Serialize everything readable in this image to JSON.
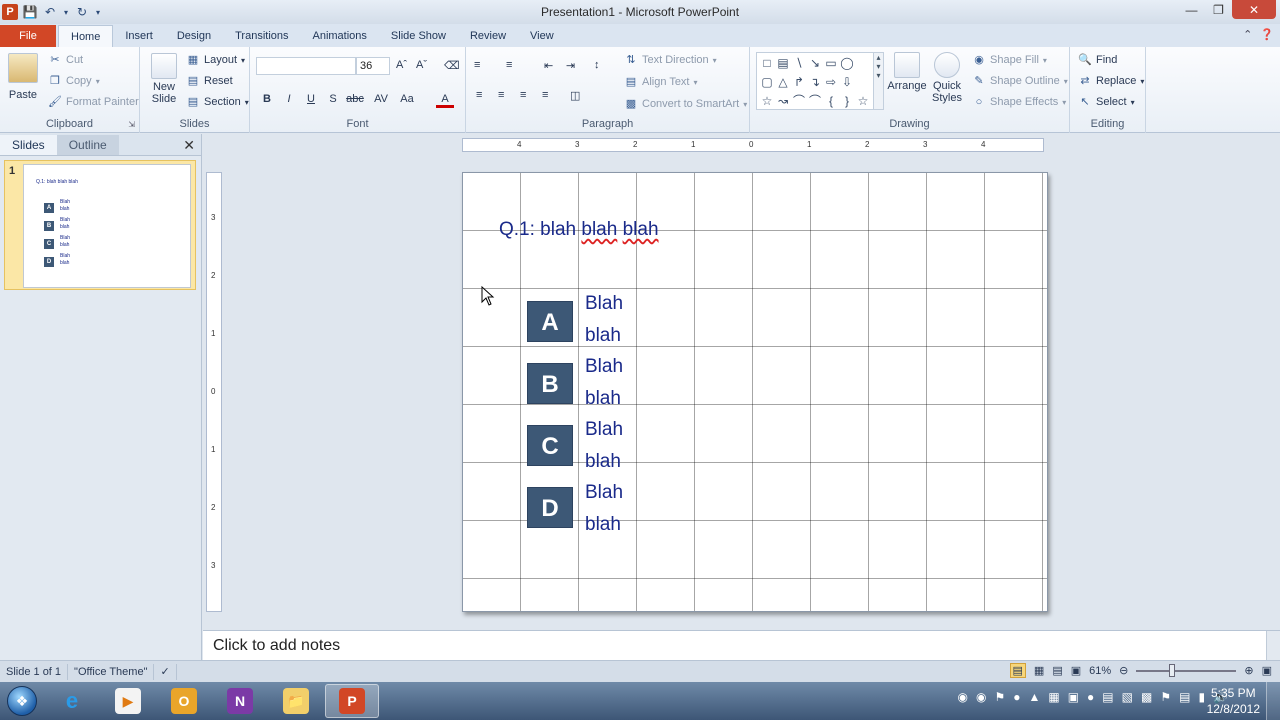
{
  "window": {
    "title": "Presentation1 - Microsoft PowerPoint",
    "app_letter": "P"
  },
  "tabs": [
    {
      "label": "File"
    },
    {
      "label": "Home"
    },
    {
      "label": "Insert"
    },
    {
      "label": "Design"
    },
    {
      "label": "Transitions"
    },
    {
      "label": "Animations"
    },
    {
      "label": "Slide Show"
    },
    {
      "label": "Review"
    },
    {
      "label": "View"
    }
  ],
  "ribbon": {
    "clipboard": {
      "label": "Clipboard",
      "paste": "Paste",
      "cut": "Cut",
      "copy": "Copy",
      "format_painter": "Format Painter"
    },
    "slides": {
      "label": "Slides",
      "new_slide_1": "New",
      "new_slide_2": "Slide",
      "layout": "Layout",
      "reset": "Reset",
      "section": "Section"
    },
    "font": {
      "label": "Font",
      "font_name": "",
      "font_size": "36"
    },
    "paragraph": {
      "label": "Paragraph",
      "text_direction": "Text Direction",
      "align_text": "Align Text",
      "smartart": "Convert to SmartArt"
    },
    "drawing": {
      "label": "Drawing",
      "arrange": "Arrange",
      "quick_styles_1": "Quick",
      "quick_styles_2": "Styles",
      "shape_fill": "Shape Fill",
      "shape_outline": "Shape Outline",
      "shape_effects": "Shape Effects"
    },
    "editing": {
      "label": "Editing",
      "find": "Find",
      "replace": "Replace",
      "select": "Select"
    }
  },
  "left_pane": {
    "tab_slides": "Slides",
    "tab_outline": "Outline",
    "slide_number": "1",
    "thumb_title": "Q.1: blah blah blah"
  },
  "slide": {
    "title_prefix": "Q.1: blah ",
    "title_w2": "blah",
    "title_w3": "blah",
    "options": [
      {
        "letter": "A",
        "line1": "Blah",
        "line2": "blah"
      },
      {
        "letter": "B",
        "line1": "Blah",
        "line2": "blah"
      },
      {
        "letter": "C",
        "line1": "Blah",
        "line2": "blah"
      },
      {
        "letter": "D",
        "line1": "Blah",
        "line2": "blah"
      }
    ]
  },
  "notes": {
    "placeholder": "Click to add notes"
  },
  "status": {
    "slide_info": "Slide 1 of 1",
    "theme": "\"Office Theme\"",
    "zoom": "61%",
    "zoom_fraction": 0.36
  },
  "taskbar": {
    "time": "5:35 PM",
    "date": "12/8/2012"
  },
  "colors": {
    "file_tab": "#d24726",
    "option_box": "#3d5876",
    "slide_text": "#1a2a8a"
  }
}
